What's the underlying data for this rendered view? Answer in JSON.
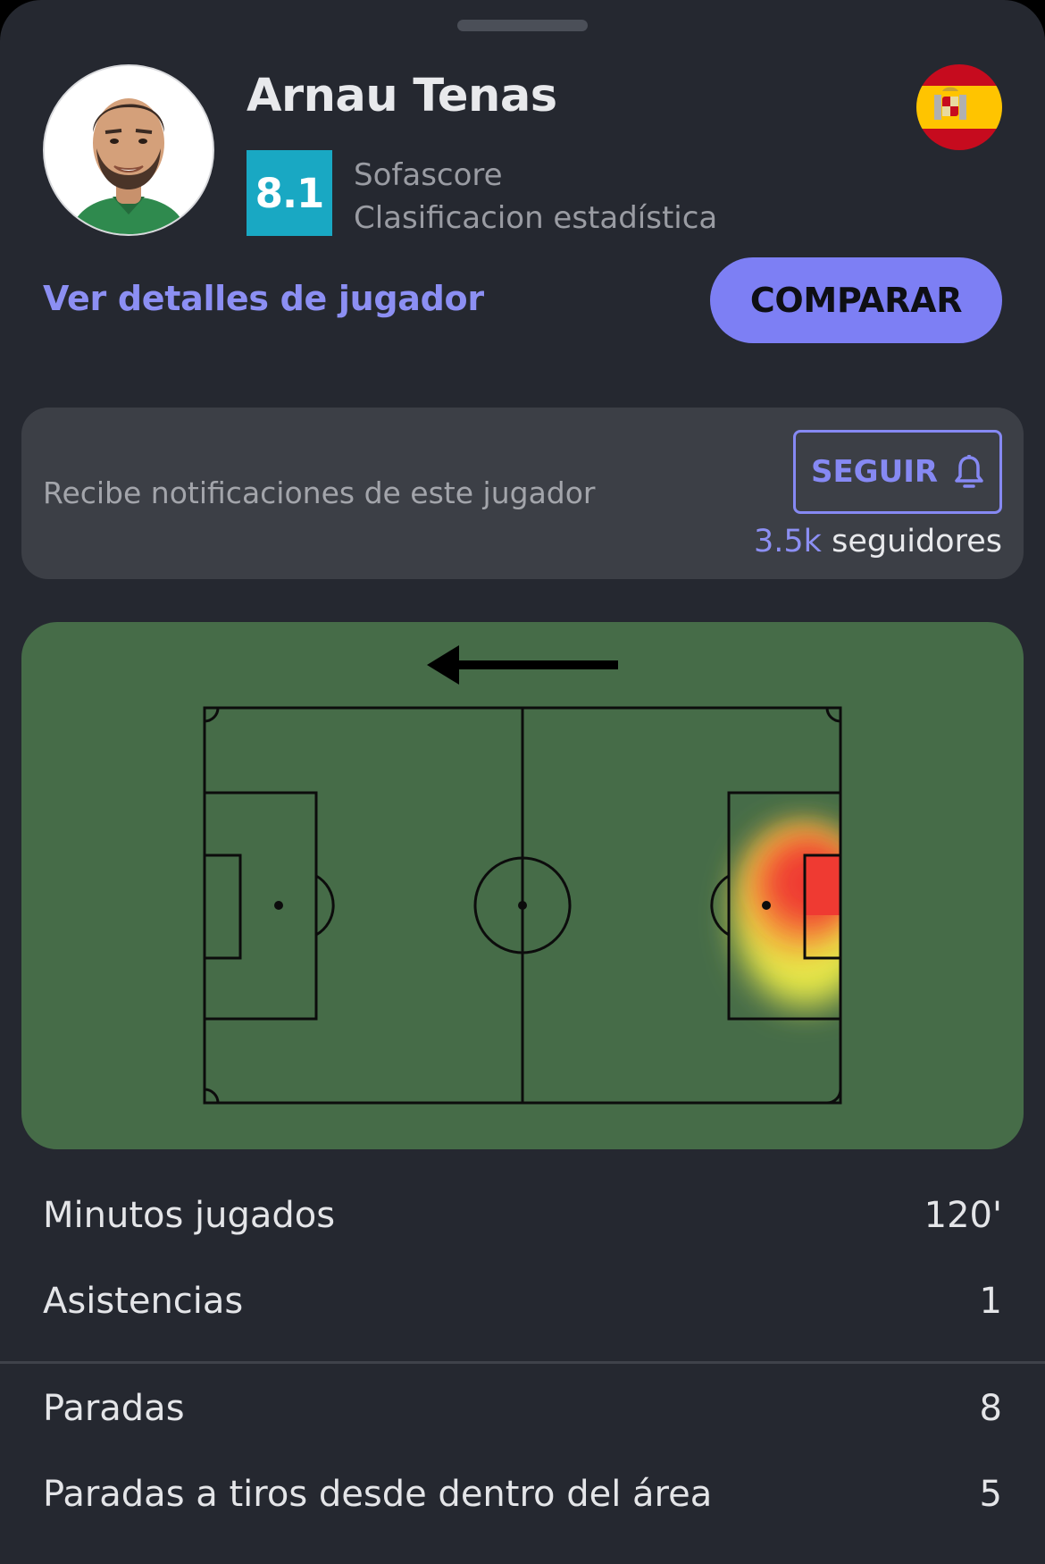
{
  "player": {
    "name": "Arnau Tenas",
    "rating": "8.1",
    "rating_source_line1": "Sofascore",
    "rating_source_line2": "Clasificacion estadística",
    "flag_icon": "spain-flag-icon"
  },
  "actions": {
    "details_link": "Ver detalles de jugador",
    "compare_button": "COMPARAR"
  },
  "follow": {
    "text": "Recibe notificaciones de este jugador",
    "button_label": "SEGUIR",
    "button_icon": "bell-icon",
    "followers_count": "3.5k",
    "followers_label": "seguidores"
  },
  "heatmap": {
    "attack_direction": "left",
    "direction_icon": "arrow-left-icon",
    "hot_zone": "own penalty area (right goal)"
  },
  "stats": [
    {
      "label": "Minutos jugados",
      "value": "120'"
    },
    {
      "label": "Asistencias",
      "value": "1"
    },
    {
      "label": "Paradas",
      "value": "8"
    },
    {
      "label": "Paradas a tiros desde dentro del área",
      "value": "5"
    }
  ],
  "colors": {
    "background": "#252830",
    "accent": "#7d7ff4",
    "rating_box": "#19a8c3",
    "pitch": "#466c48",
    "card": "#3c3f46"
  }
}
